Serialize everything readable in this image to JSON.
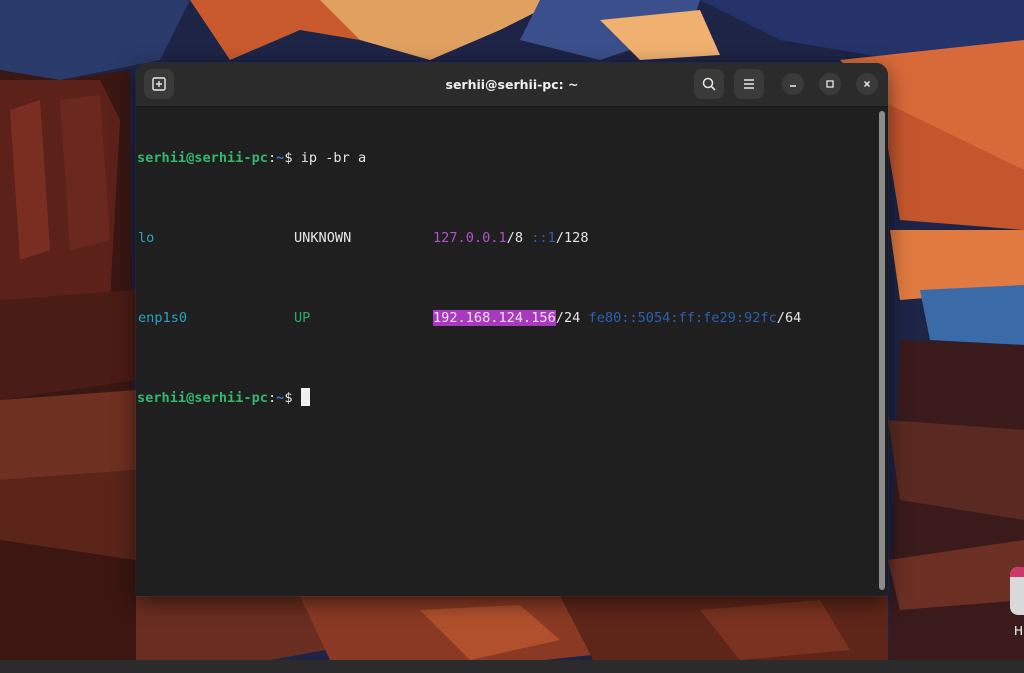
{
  "window": {
    "title": "serhii@serhii-pc: ~"
  },
  "toolbar": {
    "new_tab_icon": "new-tab-icon",
    "search_icon": "search-icon",
    "menu_icon": "hamburger-menu-icon",
    "minimize_icon": "minimize-icon",
    "maximize_icon": "maximize-icon",
    "close_icon": "close-icon"
  },
  "terminal": {
    "lines": [
      {
        "user": "serhii@serhii-pc",
        "sep": ":",
        "path": "~",
        "symbol": "$",
        "command": " ip -br a"
      },
      {
        "iface": "lo",
        "state": "UNKNOWN",
        "addr_main": "127.0.0.1",
        "addr_main_suffix": "/8",
        "addr_v6": "::1",
        "addr_v6_suffix": "/128"
      },
      {
        "iface": "enp1s0",
        "state": "UP",
        "addr_main": "192.168.124.156",
        "addr_main_suffix": "/24",
        "addr_v6": "fe80::5054:ff:fe29:92fc",
        "addr_v6_suffix": "/64"
      },
      {
        "user": "serhii@serhii-pc",
        "sep": ":",
        "path": "~",
        "symbol": "$",
        "command": " "
      }
    ]
  },
  "desktop": {
    "edge_label": "H"
  },
  "colors": {
    "prompt_user": "#33b86e",
    "prompt_path": "#3a7ad6",
    "interface": "#2aa3c0",
    "state_up": "#2ea868",
    "ipv4": "#b350c8",
    "ipv6": "#2c5fb0",
    "selection": "#a83bbd",
    "terminal_bg": "#1f1f1f",
    "titlebar_bg": "#2b2b2b"
  }
}
